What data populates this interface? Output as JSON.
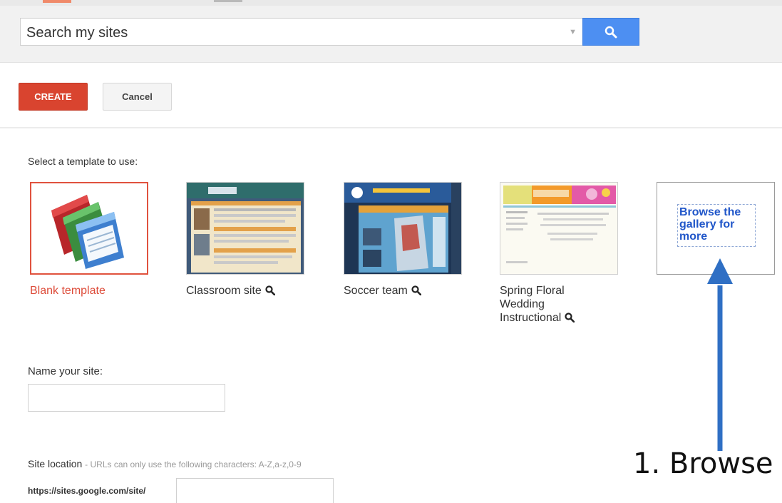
{
  "search": {
    "placeholder": "Search my sites"
  },
  "toolbar": {
    "create_label": "CREATE",
    "cancel_label": "Cancel"
  },
  "template_section": {
    "prompt": "Select a template to use:"
  },
  "templates": [
    {
      "name": "Blank template",
      "selected": true
    },
    {
      "name": "Classroom site",
      "selected": false
    },
    {
      "name": "Soccer team",
      "selected": false
    },
    {
      "name_lines": [
        "Spring Floral",
        "Wedding",
        "Instructional"
      ],
      "selected": false
    }
  ],
  "browse_gallery": {
    "text": "Browse the gallery for more"
  },
  "site_name": {
    "label": "Name your site:",
    "value": ""
  },
  "site_location": {
    "label": "Site location",
    "hint": "- URLs can only use the following characters: A-Z,a-z,0-9",
    "url_prefix": "https://sites.google.com/site/",
    "value": ""
  },
  "annotation": {
    "text": "1. Browse"
  },
  "colors": {
    "accent_red": "#d9442f",
    "search_blue": "#4d8ff2",
    "annotation_arrow": "#2f6fc4"
  },
  "icons": [
    "search-icon",
    "magnifier-icon",
    "dropdown-caret-icon",
    "up-arrow-icon"
  ]
}
